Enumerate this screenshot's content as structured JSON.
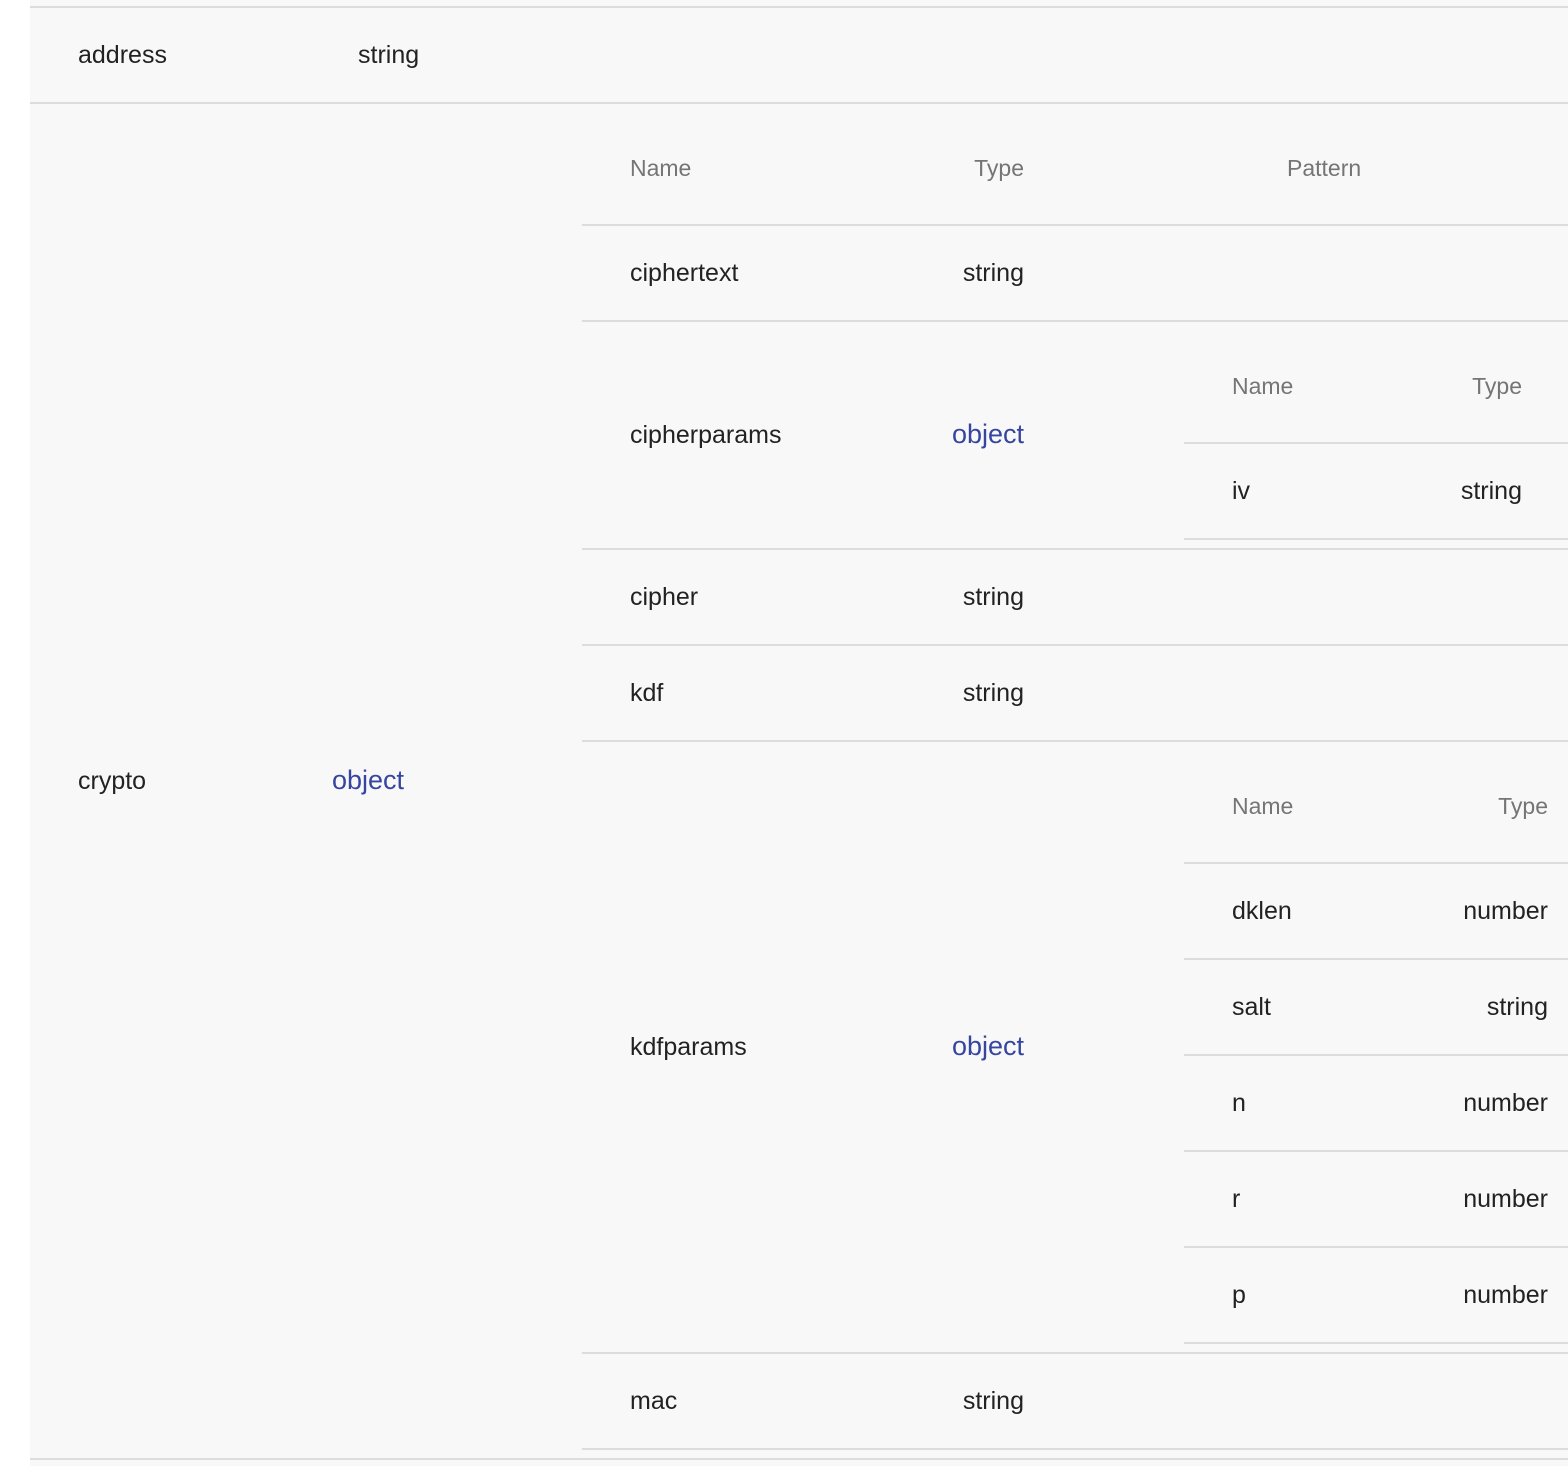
{
  "rows": [
    {
      "name": "address",
      "type": "string"
    },
    {
      "name": "crypto",
      "type": "object"
    }
  ],
  "crypto_table": {
    "headers": {
      "name": "Name",
      "type": "Type",
      "pattern": "Pattern"
    },
    "rows": [
      {
        "name": "ciphertext",
        "type": "string"
      },
      {
        "name": "cipherparams",
        "type": "object"
      },
      {
        "name": "cipher",
        "type": "string"
      },
      {
        "name": "kdf",
        "type": "string"
      },
      {
        "name": "kdfparams",
        "type": "object"
      },
      {
        "name": "mac",
        "type": "string"
      }
    ]
  },
  "cipherparams_table": {
    "headers": {
      "name": "Name",
      "type": "Type"
    },
    "rows": [
      {
        "name": "iv",
        "type": "string"
      }
    ]
  },
  "kdfparams_table": {
    "headers": {
      "name": "Name",
      "type": "Type"
    },
    "rows": [
      {
        "name": "dklen",
        "type": "number"
      },
      {
        "name": "salt",
        "type": "string"
      },
      {
        "name": "n",
        "type": "number"
      },
      {
        "name": "r",
        "type": "number"
      },
      {
        "name": "p",
        "type": "number"
      }
    ]
  },
  "colors": {
    "link": "#3646a0",
    "background": "#f8f8f8",
    "divider": "#dcdcdc",
    "header_text": "#757575"
  }
}
